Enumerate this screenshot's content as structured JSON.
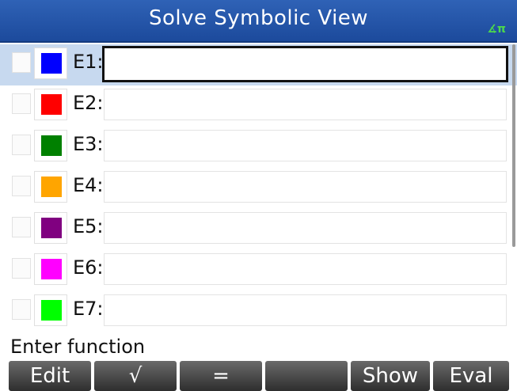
{
  "titlebar": {
    "title": "Solve Symbolic View",
    "angle_indicator": "∡π"
  },
  "equations": [
    {
      "label": "E1:",
      "color": "#0000ff",
      "value": ""
    },
    {
      "label": "E2:",
      "color": "#ff0000",
      "value": ""
    },
    {
      "label": "E3:",
      "color": "#008000",
      "value": ""
    },
    {
      "label": "E4:",
      "color": "#ffa500",
      "value": ""
    },
    {
      "label": "E5:",
      "color": "#800080",
      "value": ""
    },
    {
      "label": "E6:",
      "color": "#ff00ff",
      "value": ""
    },
    {
      "label": "E7:",
      "color": "#00ff00",
      "value": ""
    }
  ],
  "status": {
    "text": "Enter function"
  },
  "menu": {
    "edit": "Edit",
    "check": "√",
    "equals": "=",
    "empty": "",
    "show": "Show",
    "eval": "Eval"
  }
}
